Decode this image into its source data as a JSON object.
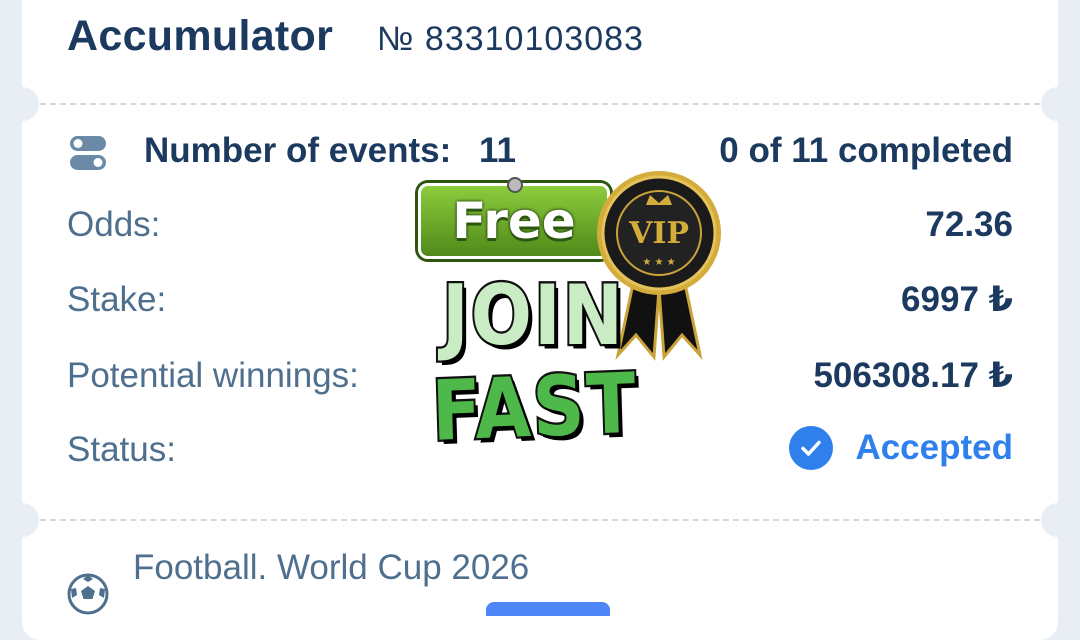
{
  "bet": {
    "type": "Accumulator",
    "ticket_number": "№ 83310103083"
  },
  "summary": {
    "events_label": "Number of events:",
    "events_count": "11",
    "completed": "0 of 11 completed"
  },
  "rows": [
    {
      "label": "Odds:",
      "value": "72.36"
    },
    {
      "label": "Stake:",
      "value": "6997 ₺"
    },
    {
      "label": "Potential winnings:",
      "value": "506308.17 ₺"
    },
    {
      "label": "Status:",
      "value": "Accepted"
    }
  ],
  "event": {
    "league": "Football. World Cup 2026"
  },
  "promo": {
    "free": "Free",
    "vip": "VIP",
    "join": "JOIN",
    "fast": "FAST"
  },
  "colors": {
    "primary_text": "#1c3a5f",
    "secondary_text": "#4f6f8e",
    "accent": "#2f80ed"
  },
  "icons": [
    "events-toggle-icon",
    "check-circle-icon",
    "football-icon",
    "vip-rosette-icon"
  ]
}
